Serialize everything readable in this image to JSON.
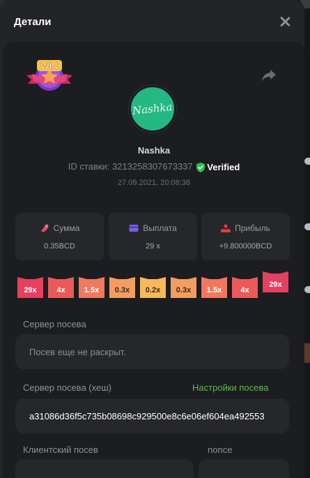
{
  "header": {
    "title": "Детали"
  },
  "bet": {
    "username": "Nashka",
    "avatar_text": "Nashka",
    "badge_text": "WIN",
    "bet_id_label": "ID ставки:",
    "bet_id": "3213258307673337",
    "verified_label": "Verified",
    "datetime": "27.09.2021, 20:08:38"
  },
  "stats": [
    {
      "label": "Сумма",
      "value": "0.35BCD",
      "icon": "coins-icon",
      "color": "#e0476a"
    },
    {
      "label": "Выплата",
      "value": "29 x",
      "icon": "card-icon",
      "color": "#7b5cf0"
    },
    {
      "label": "Прибыль",
      "value": "+9.800000BCD",
      "icon": "hand-coin-icon",
      "color": "#e23c3c"
    }
  ],
  "multipliers": [
    {
      "label": "29x",
      "color": "#e5405e"
    },
    {
      "label": "4x",
      "color": "#ea5a5a"
    },
    {
      "label": "1.5x",
      "color": "#f0785e"
    },
    {
      "label": "0.3x",
      "color": "#f49c62"
    },
    {
      "label": "0.2x",
      "color": "#f7b85c"
    },
    {
      "label": "0.3x",
      "color": "#f49c62"
    },
    {
      "label": "1.5x",
      "color": "#f0785e"
    },
    {
      "label": "4x",
      "color": "#ea5a5a"
    },
    {
      "label": "29x",
      "color": "#e5405e"
    }
  ],
  "seeds": {
    "server_label": "Сервер посева",
    "server_value": "Посев еще не раскрыт.",
    "server_hash_label": "Сервер посева (хеш)",
    "settings_link": "Настройки посева",
    "server_hash_value": "a31086d36f5c735b08698c929500e8c6e06ef604ea492553",
    "client_label": "Клиентский посев",
    "nonce_label": "nonce"
  },
  "colors": {
    "verified": "#2fbd4e",
    "link": "#5dbb46",
    "avatar": "#23b884"
  }
}
